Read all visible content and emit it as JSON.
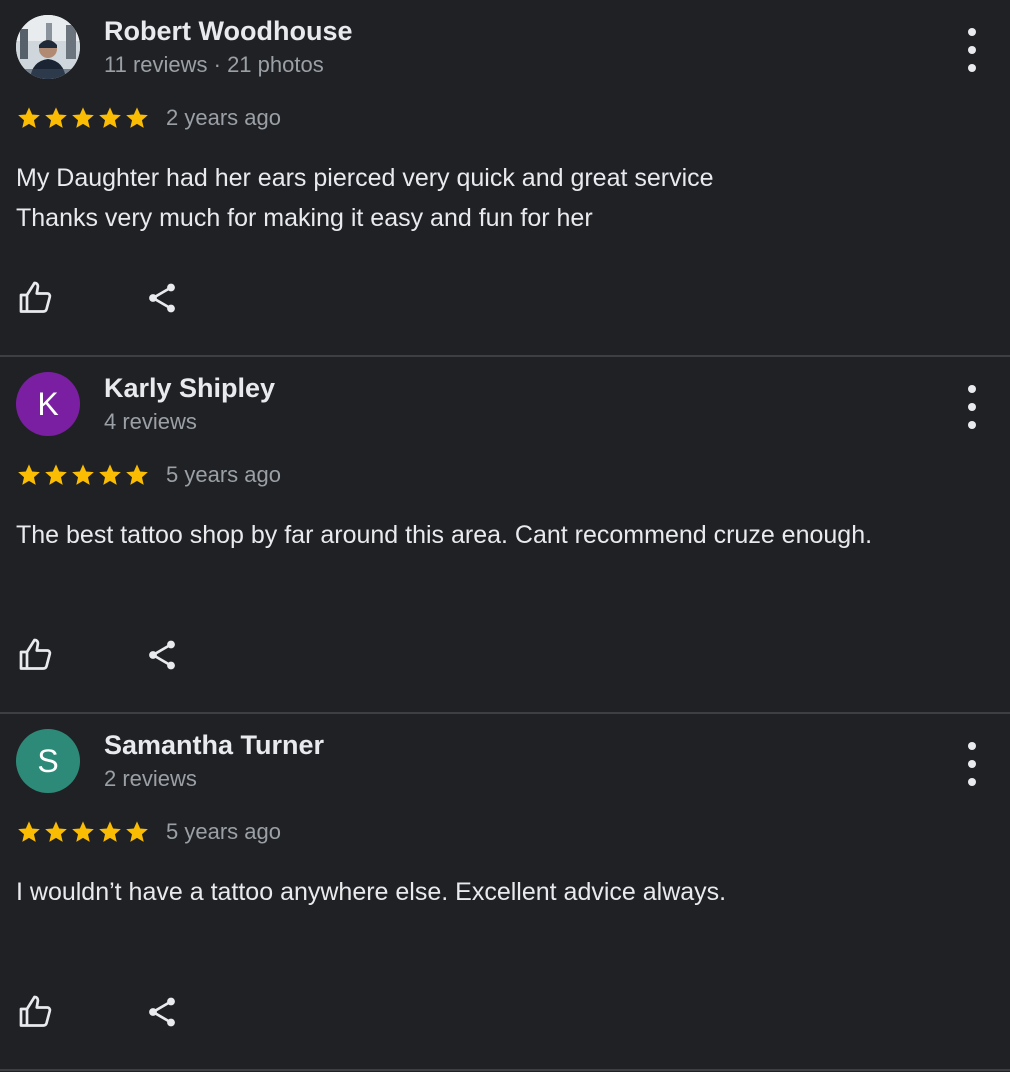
{
  "colors": {
    "background": "#202124",
    "divider": "#3c4043",
    "star": "#fbbc04",
    "text_primary": "#e8eaed",
    "text_secondary": "#9aa0a6"
  },
  "reviews": [
    {
      "name": "Robert Woodhouse",
      "meta": "11 reviews · 21 photos",
      "avatar": {
        "type": "photo",
        "icon": "user-photo"
      },
      "rating": 5,
      "time": "2 years ago",
      "text": [
        "My Daughter had her ears pierced very quick and great service",
        "Thanks very much for making it easy and fun for her"
      ]
    },
    {
      "name": "Karly Shipley",
      "meta": "4 reviews",
      "avatar": {
        "type": "letter",
        "letter": "K",
        "color": "#7b1fa2"
      },
      "rating": 5,
      "time": "5 years ago",
      "text": [
        "The best tattoo shop by far around this area. Cant recommend cruze enough."
      ]
    },
    {
      "name": "Samantha Turner",
      "meta": "2 reviews",
      "avatar": {
        "type": "letter",
        "letter": "S",
        "color": "#2e8a78"
      },
      "rating": 5,
      "time": "5 years ago",
      "text": [
        "I wouldn’t have a tattoo anywhere else. Excellent advice always."
      ]
    }
  ]
}
